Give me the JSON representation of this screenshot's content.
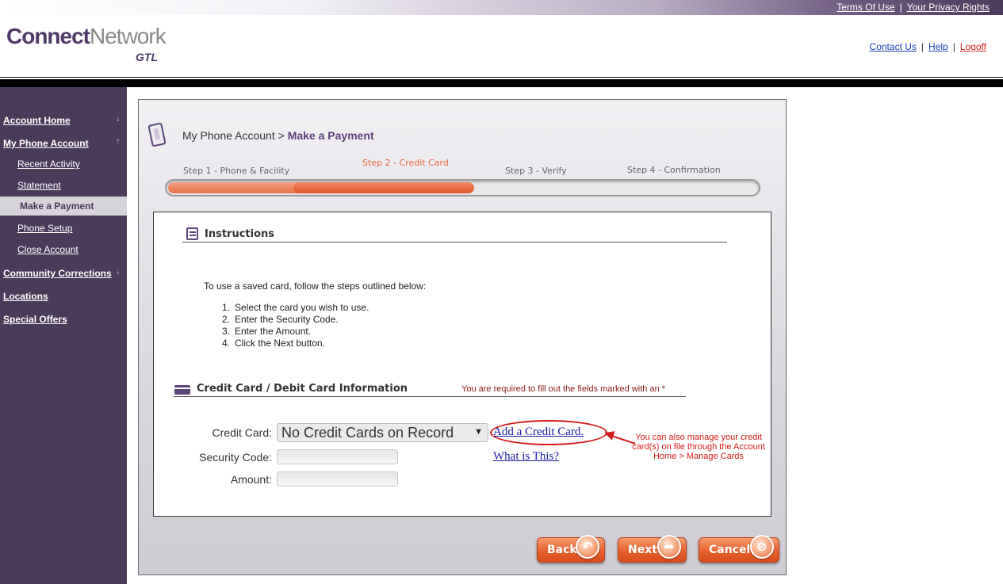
{
  "top_links": {
    "terms": "Terms Of Use",
    "privacy": "Your Privacy Rights"
  },
  "logo": {
    "connect": "Connect",
    "network": "Network",
    "gtl": "GTL"
  },
  "header_links": {
    "contact": "Contact Us",
    "help": "Help",
    "logoff": "Logoff"
  },
  "sidebar": {
    "account_home": "Account Home",
    "my_phone_account": "My Phone Account",
    "recent_activity": "Recent Activity",
    "statement": "Statement",
    "make_payment": "Make a Payment",
    "phone_setup": "Phone Setup",
    "close_account": "Close Account",
    "community_corrections": "Community Corrections",
    "locations": "Locations",
    "special_offers": "Special Offers"
  },
  "breadcrumb": {
    "parent": "My Phone Account >",
    "current": "Make a Payment"
  },
  "wizard": {
    "steps": [
      "Step 1 - Phone & Facility",
      "Step 2 - Credit Card",
      "Step 3 - Verify",
      "Step 4 - Confirmation"
    ],
    "active_step": 2,
    "progress_fraction": 0.52
  },
  "instructions": {
    "title": "Instructions",
    "intro": "To use a saved card, follow the steps outlined below:",
    "steps": [
      {
        "n": "1.",
        "text": "Select the card you wish to use."
      },
      {
        "n": "2.",
        "text": "Enter the Security Code."
      },
      {
        "n": "3.",
        "text": "Enter the Amount."
      },
      {
        "n": "4.",
        "text": "Click the Next button."
      }
    ]
  },
  "card_section": {
    "title": "Credit Card / Debit Card Information",
    "required_note": "You are required to fill out the fields marked with an *",
    "credit_card_label": "Credit Card:",
    "credit_card_value": "No Credit Cards on Record",
    "security_code_label": "Security Code:",
    "amount_label": "Amount:",
    "add_card_link": "Add a Credit Card.",
    "what_is_this_link": "What is This?",
    "annotation": "You can also manage your credit card(s) on file through the Account Home > Manage Cards"
  },
  "buttons": {
    "back": "Back",
    "next": "Next",
    "cancel": "Cancel"
  },
  "colors": {
    "brand_purple": "#4a3b5b",
    "accent_orange": "#e8673f",
    "link_blue": "#1a3fb0",
    "annotation_red": "#d41a1a"
  }
}
